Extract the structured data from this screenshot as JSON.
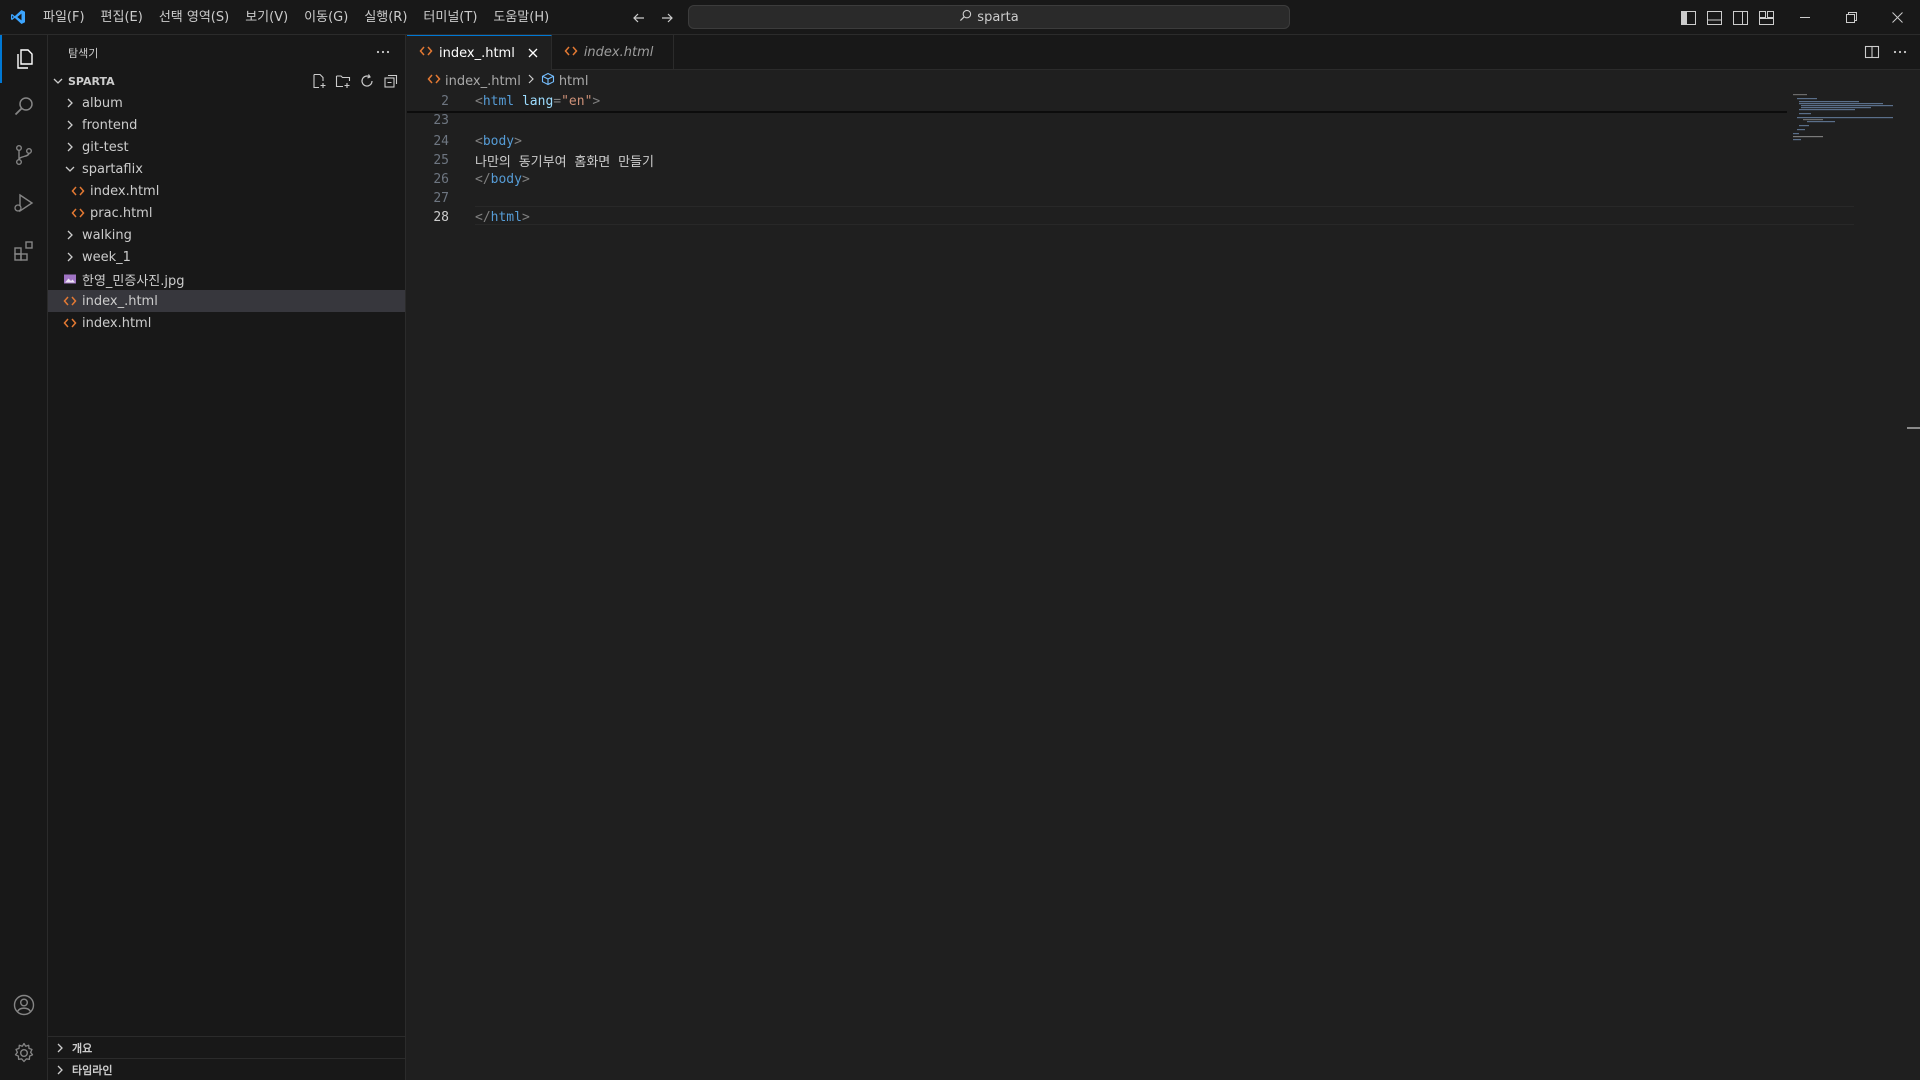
{
  "menu": [
    "파일(F)",
    "편집(E)",
    "선택 영역(S)",
    "보기(V)",
    "이동(G)",
    "실행(R)",
    "터미널(T)",
    "도움말(H)"
  ],
  "search": {
    "text": "sparta"
  },
  "explorer": {
    "title": "탐색기",
    "root": "SPARTA",
    "tree": [
      {
        "label": "album",
        "kind": "folder",
        "expanded": false,
        "depth": 1
      },
      {
        "label": "frontend",
        "kind": "folder",
        "expanded": false,
        "depth": 1
      },
      {
        "label": "git-test",
        "kind": "folder",
        "expanded": false,
        "depth": 1
      },
      {
        "label": "spartaflix",
        "kind": "folder",
        "expanded": true,
        "depth": 1
      },
      {
        "label": "index.html",
        "kind": "html",
        "depth": 2
      },
      {
        "label": "prac.html",
        "kind": "html",
        "depth": 2
      },
      {
        "label": "walking",
        "kind": "folder",
        "expanded": false,
        "depth": 1
      },
      {
        "label": "week_1",
        "kind": "folder",
        "expanded": false,
        "depth": 1
      },
      {
        "label": "한영_민증사진.jpg",
        "kind": "image",
        "depth": 1
      },
      {
        "label": "index_.html",
        "kind": "html",
        "depth": 1,
        "selected": true
      },
      {
        "label": "index.html",
        "kind": "html",
        "depth": 1
      }
    ],
    "bottom_sections": [
      "개요",
      "타임라인"
    ]
  },
  "tabs": [
    {
      "label": "index_.html",
      "active": true
    },
    {
      "label": "index.html",
      "active": false
    }
  ],
  "breadcrumbs": {
    "file": "index_.html",
    "symbol": "html"
  },
  "code_lines": [
    {
      "num": "2",
      "parts": [
        [
          "tag",
          "<"
        ],
        [
          "tagname",
          "html"
        ],
        [
          "plain",
          " "
        ],
        [
          "attr",
          "lang"
        ],
        [
          "tag",
          "="
        ],
        [
          "str",
          "\"en\""
        ],
        [
          "tag",
          ">"
        ]
      ]
    },
    {
      "num": "23",
      "parts": []
    },
    {
      "num": "24",
      "parts": [
        [
          "tag",
          "<"
        ],
        [
          "tagname",
          "body"
        ],
        [
          "tag",
          ">"
        ]
      ]
    },
    {
      "num": "25",
      "parts": [
        [
          "plain",
          "나만의 동기부여 홈화면 만들기"
        ]
      ]
    },
    {
      "num": "26",
      "parts": [
        [
          "tag",
          "</"
        ],
        [
          "tagname",
          "body"
        ],
        [
          "tag",
          ">"
        ]
      ]
    },
    {
      "num": "27",
      "parts": []
    },
    {
      "num": "28",
      "parts": [
        [
          "tag",
          "</"
        ],
        [
          "tagname",
          "html"
        ],
        [
          "tag",
          ">"
        ]
      ],
      "current": true
    }
  ],
  "colors": {
    "accent": "#0078d4",
    "html_icon": "#e37933",
    "image_icon": "#a074c4",
    "vscode_logo": "#3ca5ff"
  }
}
